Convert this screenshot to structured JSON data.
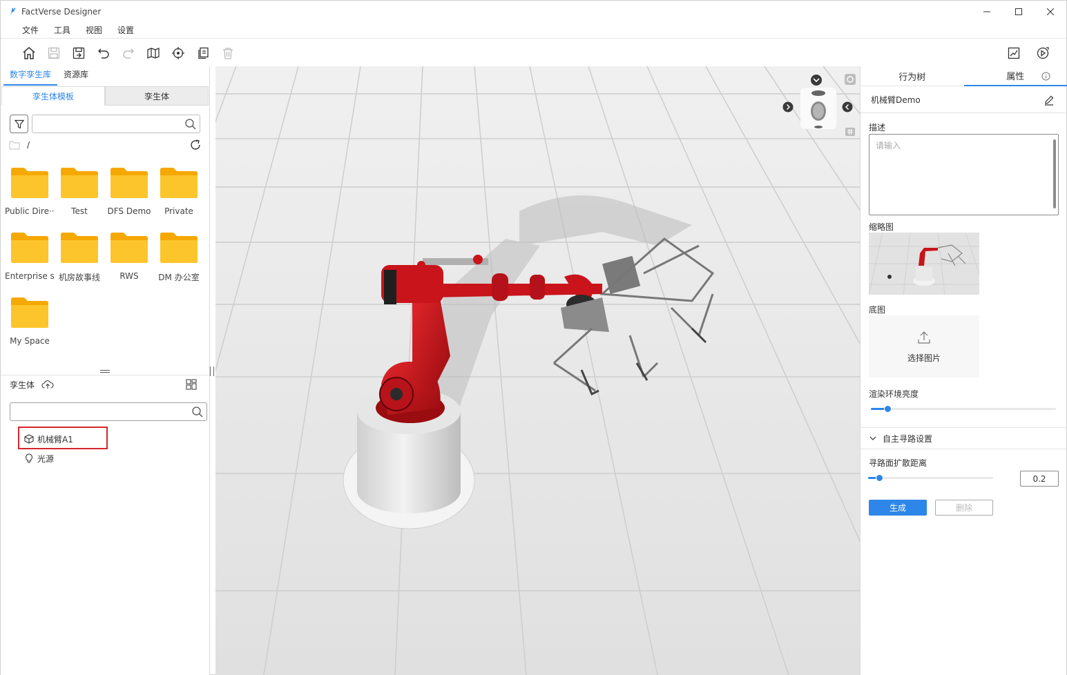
{
  "app": {
    "title": "FactVerse Designer"
  },
  "menu": {
    "items": [
      "文件",
      "工具",
      "视图",
      "设置"
    ]
  },
  "left": {
    "lib_tabs": [
      "数字孪生库",
      "资源库"
    ],
    "sub_tabs": [
      "孪生体模板",
      "孪生体"
    ],
    "search": {
      "placeholder": "",
      "value": ""
    },
    "path": "/",
    "folders": [
      "Public Dire···",
      "Test",
      "DFS Demo",
      "Private",
      "Enterprise s···",
      "机房故事线",
      "RWS",
      "DM 办公室",
      "My Space"
    ],
    "entity_header": "孪生体",
    "entity_search": {
      "placeholder": "",
      "value": ""
    },
    "tree": [
      {
        "label": "机械臂A1",
        "icon": "cube-icon"
      },
      {
        "label": "光源",
        "icon": "light-bulb-icon"
      }
    ]
  },
  "right": {
    "tabs": [
      "行为树",
      "属性"
    ],
    "object_name": "机械臂Demo",
    "description_label": "描述",
    "description_placeholder": "请输入",
    "thumbnail_label": "缩略图",
    "base_image_label": "底图",
    "choose_image": "选择图片",
    "brightness_label": "渲染环境亮度",
    "brightness_value": 0.09,
    "pathfinding_section": "自主寻路设置",
    "spread_label": "寻路面扩散距离",
    "spread_value": "0.2",
    "spread_fraction": 0.09,
    "generate_button": "生成",
    "delete_button": "删除"
  },
  "colors": {
    "accent": "#2d86e8",
    "highlight": "#d6262b",
    "folder": "#f7b500",
    "robot": "#c8141a"
  }
}
